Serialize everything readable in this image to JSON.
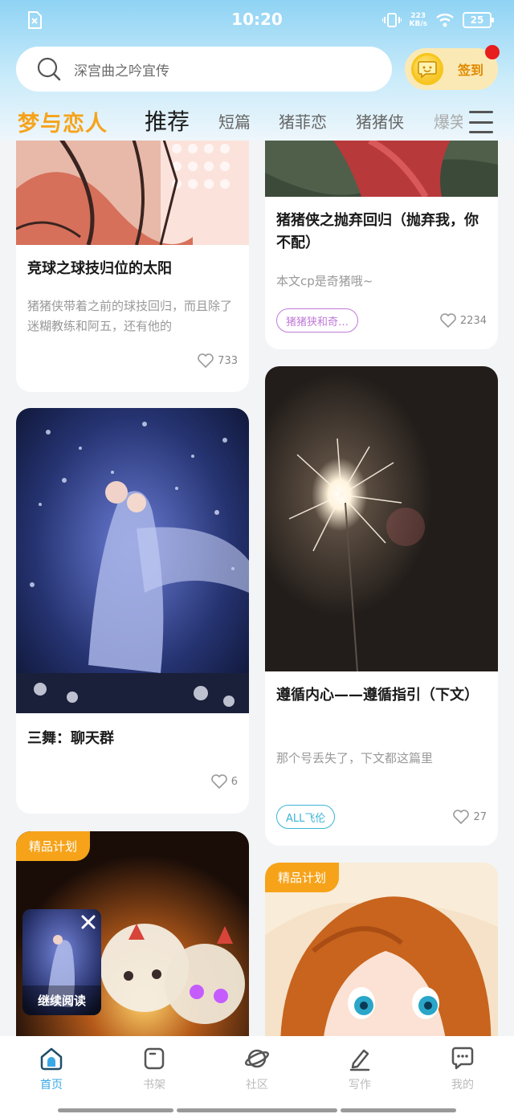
{
  "status_bar": {
    "time": "10:20",
    "speed_value": "223",
    "speed_unit": "KB/s",
    "battery": "25"
  },
  "search": {
    "placeholder": "深宫曲之吟宜传"
  },
  "checkin": {
    "label": "签到"
  },
  "tabs": {
    "logo": "梦与恋人",
    "items": [
      "推荐",
      "短篇",
      "猪菲恋",
      "猪猪侠",
      "爆笑"
    ]
  },
  "feed": {
    "left": [
      {
        "title": "竞球之球技归位的太阳",
        "desc": "猪猪侠带着之前的球技回归，而且除了迷糊教练和阿五，还有他的",
        "likes": "733"
      },
      {
        "title": "三舞：聊天群",
        "desc": "",
        "likes": "6"
      },
      {
        "badge": "精品计划"
      }
    ],
    "right": [
      {
        "title": "猪猪侠之抛弃回归（抛弃我，你不配）",
        "desc": "本文cp是奇猪哦~",
        "tag": "猪猪狭和奇…",
        "likes": "2234"
      },
      {
        "title": "遵循内心——遵循指引（下文）",
        "desc": "那个号丢失了，下文都这篇里",
        "tag": "ALL飞伦",
        "likes": "27"
      },
      {
        "badge": "精品计划"
      }
    ]
  },
  "continue_reading": {
    "label": "继续阅读"
  },
  "bottom_nav": {
    "items": [
      "首页",
      "书架",
      "社区",
      "写作",
      "我的"
    ],
    "active": "首页"
  },
  "colors": {
    "accent": "#f6a31a",
    "nav_active": "#3aa8e6",
    "tag_purple": "#c07ad8",
    "tag_cyan": "#3bb4d6"
  }
}
